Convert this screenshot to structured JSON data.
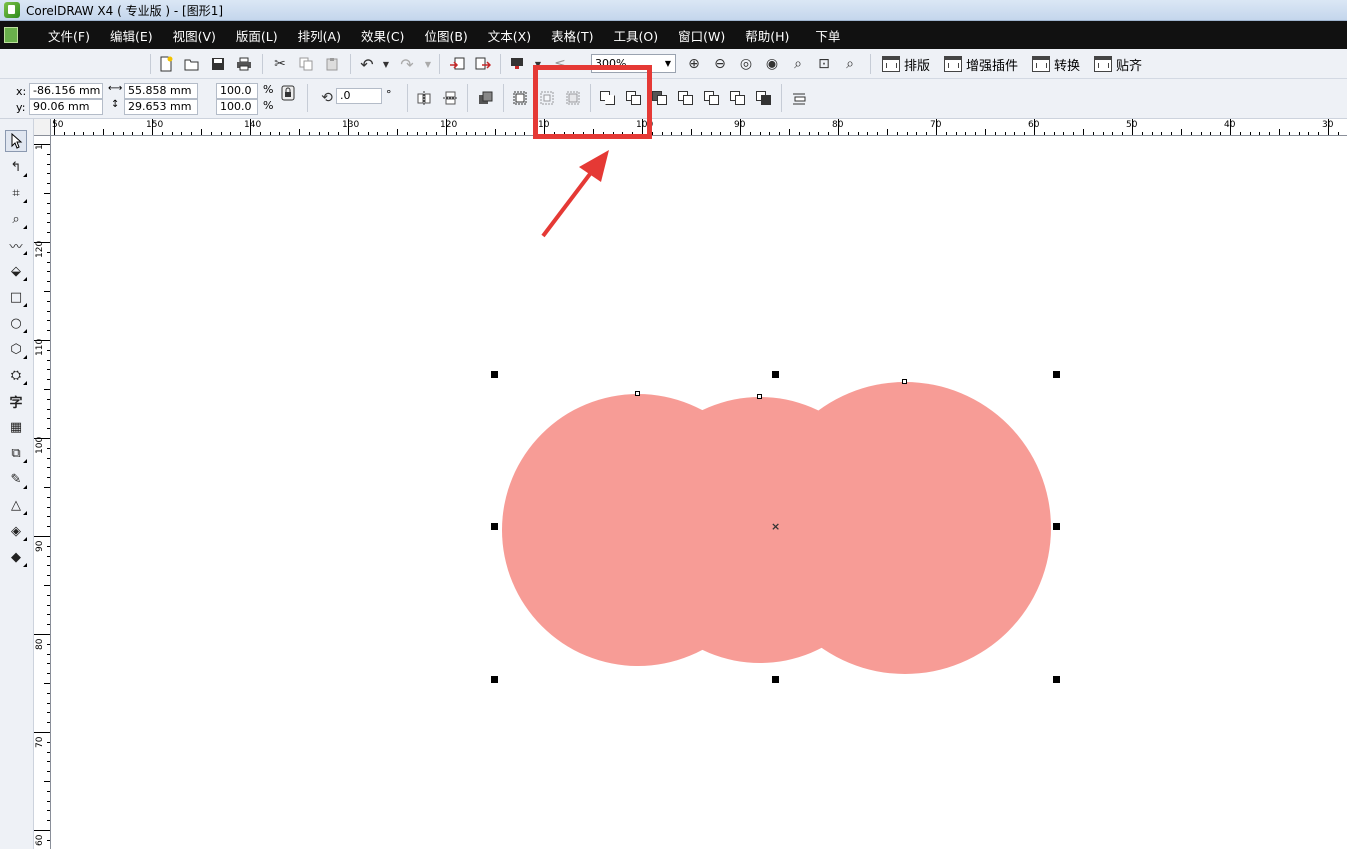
{
  "window": {
    "title": "CorelDRAW X4 ( 专业版 ) - [图形1]"
  },
  "menu": {
    "items": [
      "文件(F)",
      "编辑(E)",
      "视图(V)",
      "版面(L)",
      "排列(A)",
      "效果(C)",
      "位图(B)",
      "文本(X)",
      "表格(T)",
      "工具(O)",
      "窗口(W)",
      "帮助(H)",
      "下单"
    ]
  },
  "toolbar": {
    "zoom_value": "300%",
    "plugins": [
      "排版",
      "增强插件",
      "转换",
      "贴齐"
    ]
  },
  "property_bar": {
    "x_label": "x:",
    "y_label": "y:",
    "x_value": "-86.156 mm",
    "y_value": "90.06 mm",
    "width_value": "55.858 mm",
    "height_value": "29.653 mm",
    "scale_x": "100.0",
    "scale_y": "100.0",
    "percent": "%",
    "rotation_value": ".0",
    "degree": "°"
  },
  "ruler": {
    "horizontal_labels": [
      "50",
      "150",
      "140",
      "130",
      "120",
      "10",
      "100",
      "90",
      "80",
      "70",
      "60",
      "50",
      "40",
      "30"
    ],
    "vertical_labels": [
      "1",
      "120",
      "110",
      "100",
      "90",
      "80",
      "70",
      "60"
    ]
  },
  "drawing": {
    "fill_color": "#f79c96",
    "shape_count": 3
  },
  "annotation": {
    "color": "#e53935"
  }
}
